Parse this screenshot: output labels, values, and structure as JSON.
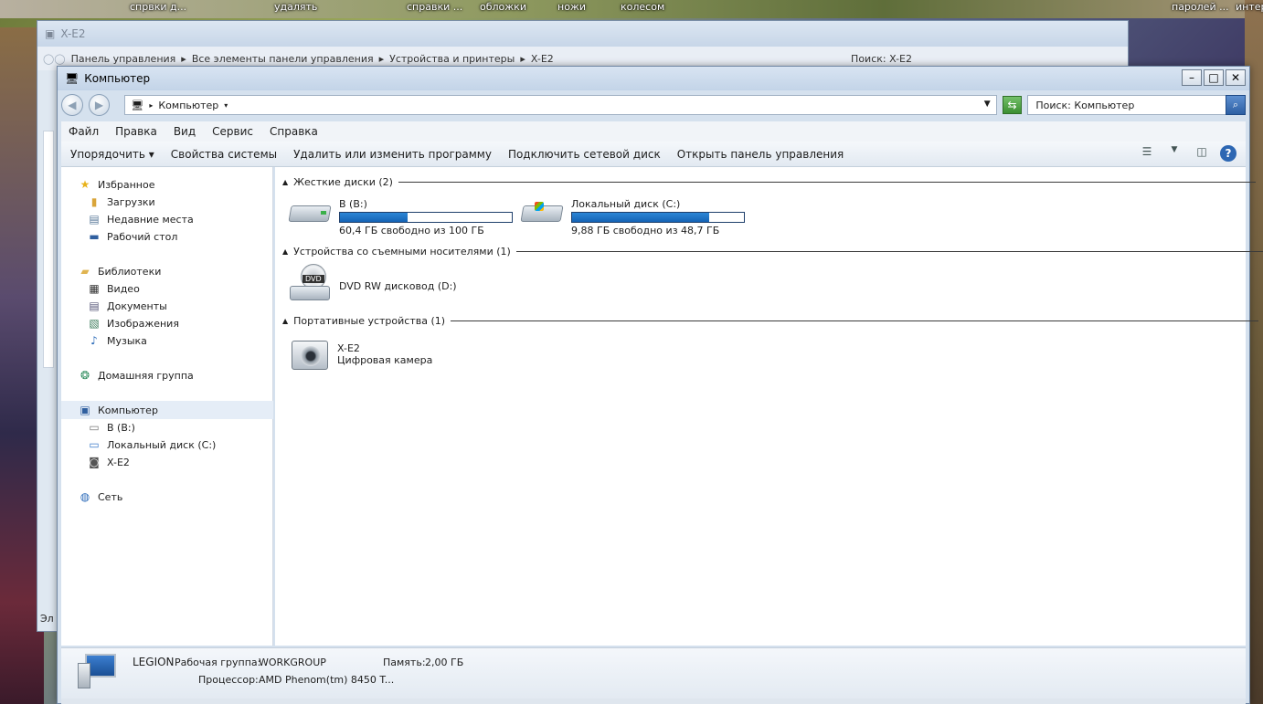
{
  "desktop": {
    "labels": [
      "спрвки д...",
      "удалять",
      "справки ...",
      "обложки",
      "ножи",
      "колесом",
      "паролей ...",
      "интер"
    ]
  },
  "bg_window": {
    "title": "X-E2",
    "address": [
      "Панель управления",
      "Все элементы панели управления",
      "Устройства и принтеры",
      "X-E2"
    ],
    "search": "Поиск: X-E2",
    "partial_label": "Эл"
  },
  "window": {
    "title": "Компьютер",
    "address": "Компьютер",
    "search_placeholder": "Поиск: Компьютер",
    "buttons": {
      "minimize": "–",
      "maximize": "□",
      "close": "✕"
    }
  },
  "menu": [
    "Файл",
    "Правка",
    "Вид",
    "Сервис",
    "Справка"
  ],
  "toolbar": {
    "organize": "Упорядочить",
    "system_properties": "Свойства системы",
    "uninstall": "Удалить или изменить программу",
    "map_drive": "Подключить сетевой диск",
    "control_panel": "Открыть панель управления"
  },
  "nav": {
    "favorites": "Избранное",
    "downloads": "Загрузки",
    "recent": "Недавние места",
    "desktop": "Рабочий стол",
    "libraries": "Библиотеки",
    "video": "Видео",
    "documents": "Документы",
    "images": "Изображения",
    "music": "Музыка",
    "homegroup": "Домашняя группа",
    "computer": "Компьютер",
    "drive_b": "В (B:)",
    "drive_c": "Локальный диск (C:)",
    "camera": "X-E2",
    "network": "Сеть"
  },
  "groups": {
    "hdd": "Жесткие диски (2)",
    "removable": "Устройства со съемными носителями (1)",
    "portable": "Портативные устройства (1)"
  },
  "drives": [
    {
      "name": "В (B:)",
      "free_text": "60,4 ГБ свободно из 100 ГБ",
      "used_fraction": 0.396
    },
    {
      "name": "Локальный диск (C:)",
      "free_text": "9,88 ГБ свободно из 48,7 ГБ",
      "used_fraction": 0.797
    }
  ],
  "dvd": {
    "name": "DVD RW дисковод (D:)",
    "badge": "DVD"
  },
  "camera": {
    "name": "X-E2",
    "type": "Цифровая камера"
  },
  "details": {
    "computer_name": "LEGION",
    "workgroup_label": "Рабочая группа:",
    "workgroup": "WORKGROUP",
    "memory_label": "Память:",
    "memory": "2,00 ГБ",
    "cpu_label": "Процессор:",
    "cpu": "AMD Phenom(tm) 8450 T..."
  }
}
